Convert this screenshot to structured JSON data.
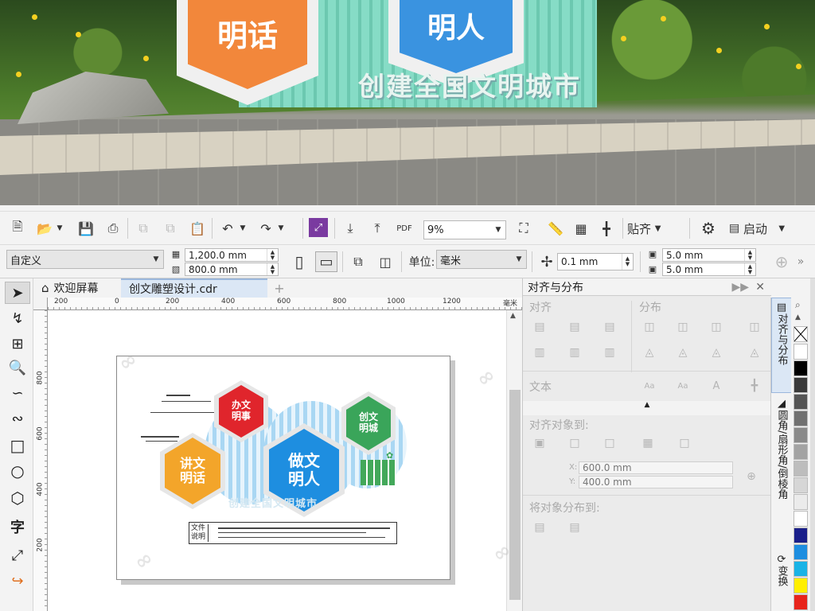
{
  "scene": {
    "hex_left_text": "明话",
    "hex_right_text": "明人",
    "slogan": "创建全国文明城市",
    "colors": {
      "orange": "#f2873b",
      "blue": "#3a93e0",
      "teal": "#86dcc6"
    }
  },
  "toolbar1": {
    "zoom": "9%",
    "snap_label": "贴齐",
    "launch_label": "启动"
  },
  "toolbar2": {
    "page_preset": "自定义",
    "width": "1,200.0 mm",
    "height": "800.0 mm",
    "unit_label": "单位:",
    "unit_value": "毫米",
    "nudge": "0.1 mm",
    "dup_x": "5.0 mm",
    "dup_y": "5.0 mm"
  },
  "tabs": {
    "home": "欢迎屏幕",
    "doc": "创文雕塑设计.cdr",
    "add": "+"
  },
  "ruler": {
    "h_labels": [
      "200",
      "0",
      "200",
      "400",
      "600",
      "800",
      "1000",
      "1200"
    ],
    "unit": "毫米",
    "v_labels": [
      "800",
      "600",
      "400",
      "200"
    ]
  },
  "design": {
    "hex1": "办文\n明事",
    "hex2": "创文\n明城",
    "hex3": "讲文\n明话",
    "hex4": "做文\n明人",
    "slogan": "创建全国文明城市",
    "label": "文件\n说明",
    "colors": {
      "red": "#e0252c",
      "green": "#3aa55a",
      "orange": "#f3a52a",
      "blue": "#1e8ee0"
    }
  },
  "docker": {
    "title": "对齐与分布",
    "sec_align": "对齐",
    "sec_distribute": "分布",
    "sec_text": "文本",
    "sec_align_to": "对齐对象到:",
    "x_value": "600.0 mm",
    "y_value": "400.0 mm",
    "x_label": "X:",
    "y_label": "Y:",
    "sec_distribute_to": "将对象分布到:"
  },
  "vtabs": {
    "align": "对齐与分布",
    "corner": "圆角/扇形角/倒棱角",
    "transform": "变换"
  },
  "palette": [
    "#ffffff",
    "#000000",
    "#3a3a3a",
    "#555555",
    "#707070",
    "#8a8a8a",
    "#a3a3a3",
    "#bdbdbd",
    "#d6d6d6",
    "#ebebeb",
    "#ffffff",
    "#1a1f8a",
    "#1e8ee0",
    "#19b3e6",
    "#ffef00",
    "#e8251c"
  ]
}
